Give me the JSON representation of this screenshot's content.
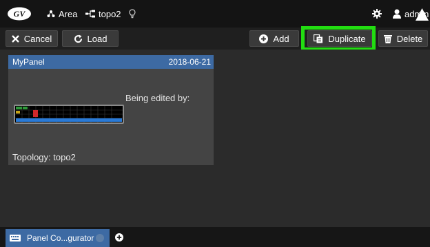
{
  "topbar": {
    "area_label": "Area",
    "topology_label": "topo2",
    "user_label": "admin",
    "icons": [
      "gv-logo-icon",
      "area-icon",
      "topology-icon",
      "lightbulb-icon",
      "gear-icon",
      "user-icon",
      "warning-icon"
    ]
  },
  "toolbar": {
    "cancel_label": "Cancel",
    "load_label": "Load",
    "add_label": "Add",
    "duplicate_label": "Duplicate",
    "delete_label": "Delete",
    "highlight_color": "#22dd11"
  },
  "panel_card": {
    "name": "MyPanel",
    "date": "2018-06-21",
    "edited_by_label": "Being edited by:",
    "topology_text": "Topology:  topo2"
  },
  "bottom_tabs": {
    "active_tab_label": "Panel Co...gurator"
  },
  "colors": {
    "accent_blue": "#3d6aa3",
    "background": "#2b2b2b",
    "topbar": "#141414"
  }
}
